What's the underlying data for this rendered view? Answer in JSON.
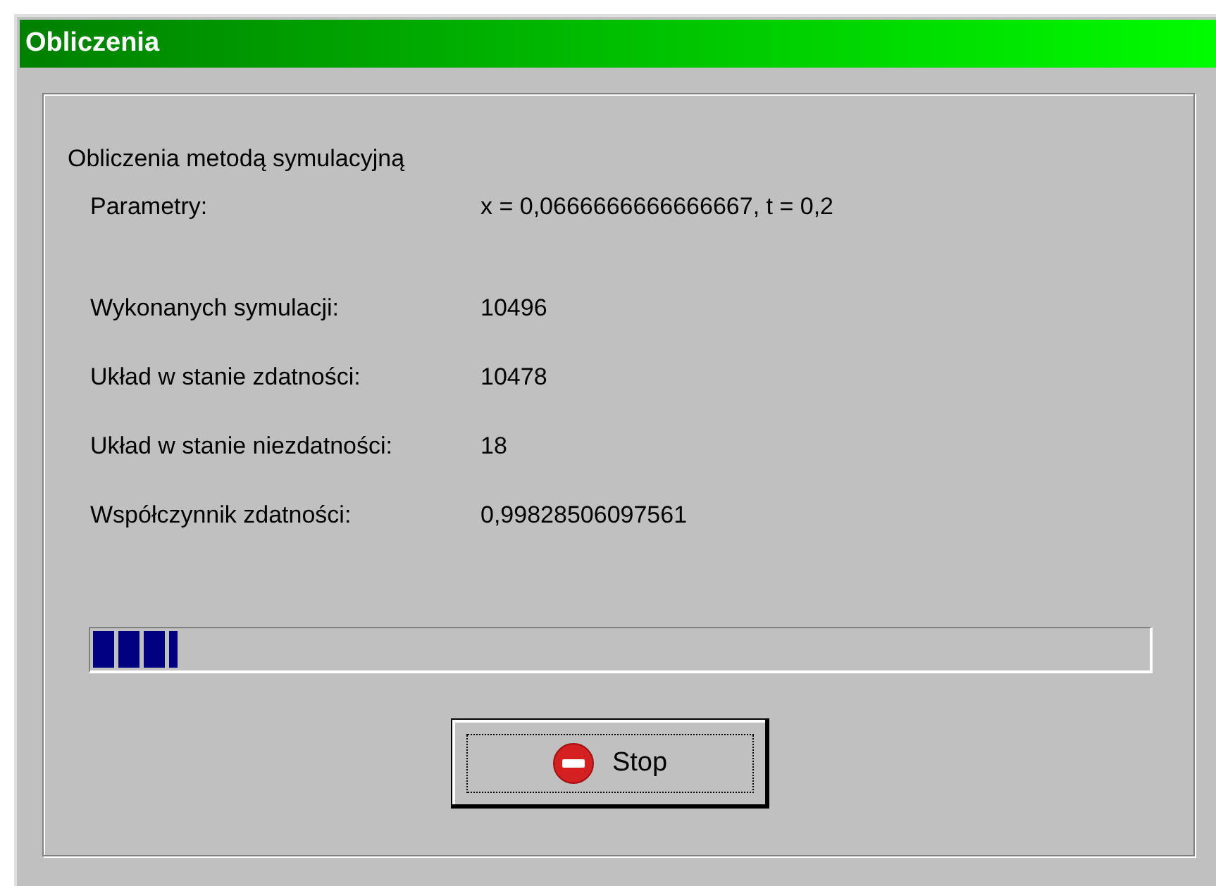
{
  "window": {
    "title": "Obliczenia"
  },
  "heading": "Obliczenia metodą symulacyjną",
  "rows": [
    {
      "label": "Parametry:",
      "value": "x = 0,0666666666666667, t = 0,2"
    },
    {
      "label": "Wykonanych symulacji:",
      "value": "10496"
    },
    {
      "label": "Układ w stanie zdatności:",
      "value": "10478"
    },
    {
      "label": "Układ w stanie niezdatności:",
      "value": "18"
    },
    {
      "label": "Współczynnik zdatności:",
      "value": "0,99828506097561"
    }
  ],
  "progress": {
    "level": 0.08
  },
  "button": {
    "label": "Stop"
  }
}
